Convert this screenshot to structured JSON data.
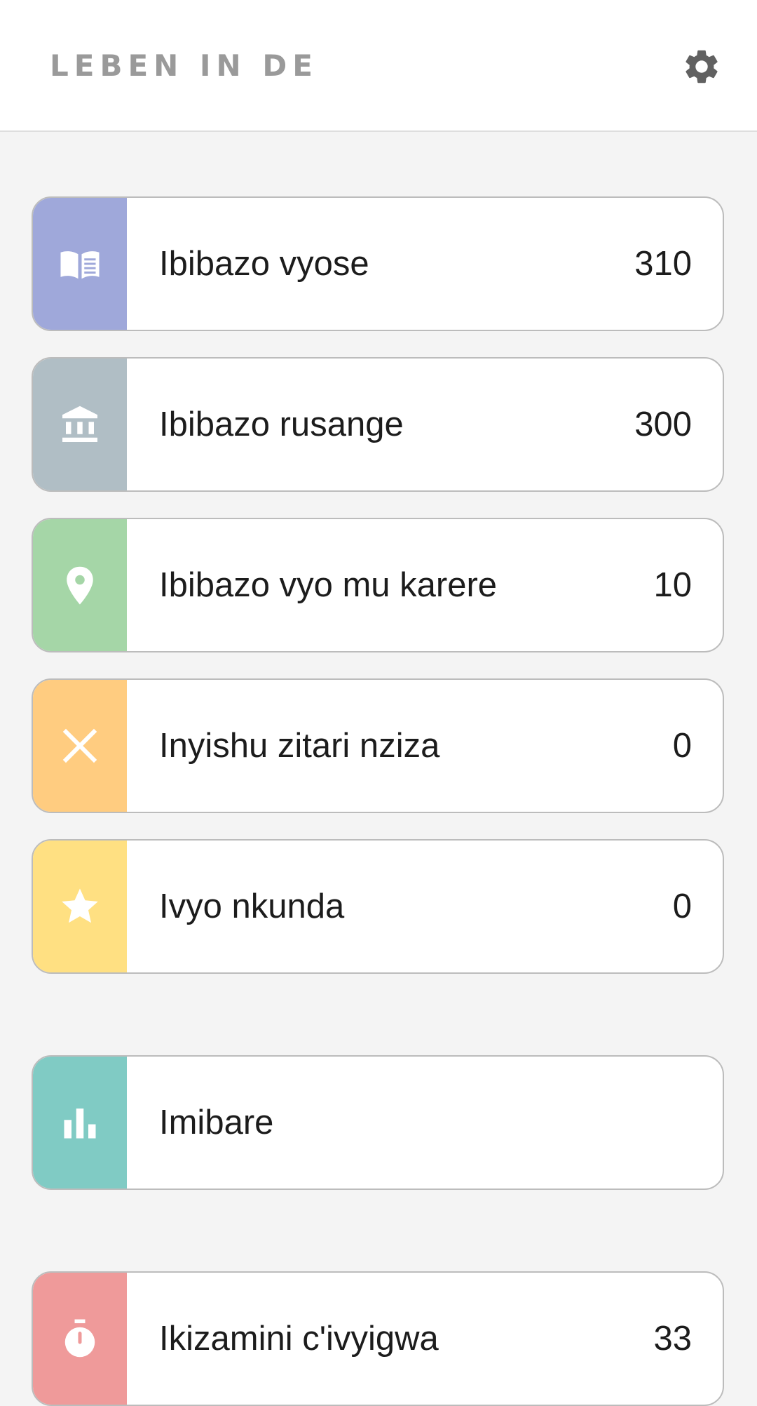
{
  "header": {
    "title": "LEBEN IN DE",
    "settings_icon": "gear-icon"
  },
  "menu": [
    {
      "label": "Ibibazo vyose",
      "count": "310",
      "icon": "open-book-icon",
      "color": "#9fa8da"
    },
    {
      "label": "Ibibazo rusange",
      "count": "300",
      "icon": "bank-icon",
      "color": "#b0bec5"
    },
    {
      "label": "Ibibazo vyo mu karere",
      "count": "10",
      "icon": "location-pin-icon",
      "color": "#a5d6a7"
    },
    {
      "label": "Inyishu zitari nziza",
      "count": "0",
      "icon": "close-icon",
      "color": "#ffcc80"
    },
    {
      "label": "Ivyo nkunda",
      "count": "0",
      "icon": "star-icon",
      "color": "#ffe082"
    },
    {
      "label": "Imibare",
      "count": "",
      "icon": "bar-chart-icon",
      "color": "#80cbc4"
    },
    {
      "label": "Ikizamini c'ivyigwa",
      "count": "33",
      "icon": "stopwatch-icon",
      "color": "#ef9a9a"
    }
  ]
}
